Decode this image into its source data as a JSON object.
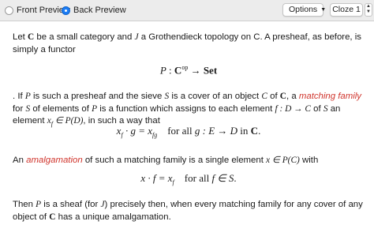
{
  "toolbar": {
    "front_preview": "Front Preview",
    "back_preview": "Back Preview",
    "options": "Options",
    "cloze": "Cloze 1"
  },
  "content": {
    "p1a": "Let ",
    "p1_C": "C",
    "p1b": " be a small category and ",
    "p1_J": "J",
    "p1c": " a Grothendieck topology on C. A presheaf, as before, is simply a functor",
    "d1_P": "P",
    "d1_colon": " : ",
    "d1_C": "C",
    "d1_op": "op",
    "d1_arrow": " → ",
    "d1_Set": "Set",
    "p2a": ". If ",
    "p2_P": "P",
    "p2b": " is such a presheaf and the sieve ",
    "p2_S": "S",
    "p2c": " is a cover of an object ",
    "p2_C2": "C",
    "p2d": " of ",
    "p2_C3": "C",
    "p2e": ", a ",
    "p2_term": "matching family",
    "p2f": " for ",
    "p2_S2": "S",
    "p2g": " of elements of ",
    "p2_P2": "P",
    "p2h": " is a function which assigns to each element ",
    "p2_f": "f : D → C",
    "p2i": " of ",
    "p2_S3": "S",
    "p2j": " an element ",
    "p2_x": "x",
    "p2_xsub": "f",
    "p2_in": " ∈ P(D)",
    "p2k": ", in such a way that",
    "d2_lhs": "x",
    "d2_lhs_sub": "f",
    "d2_mid": " · g = x",
    "d2_rhs_sub": "fg",
    "d2_forall": "for all ",
    "d2_g": "g : E → D",
    "d2_in": " in ",
    "d2_C": "C",
    "d2_dot": ".",
    "p3a": "An ",
    "p3_term": "amalgamation",
    "p3b": " of such a matching family is a single element ",
    "p3_x": "x ∈ P(C)",
    "p3c": " with",
    "d3_x": "x · f = x",
    "d3_sub": "f",
    "d3_forall": "for all ",
    "d3_f": "f ∈ S",
    "d3_dot": ".",
    "p4a": "Then ",
    "p4_P": "P",
    "p4b": " is a sheaf (for ",
    "p4_J": "J",
    "p4c": ") precisely then, when every matching family for any cover of any object of ",
    "p4_C": "C",
    "p4d": " has a unique amalgamation."
  }
}
